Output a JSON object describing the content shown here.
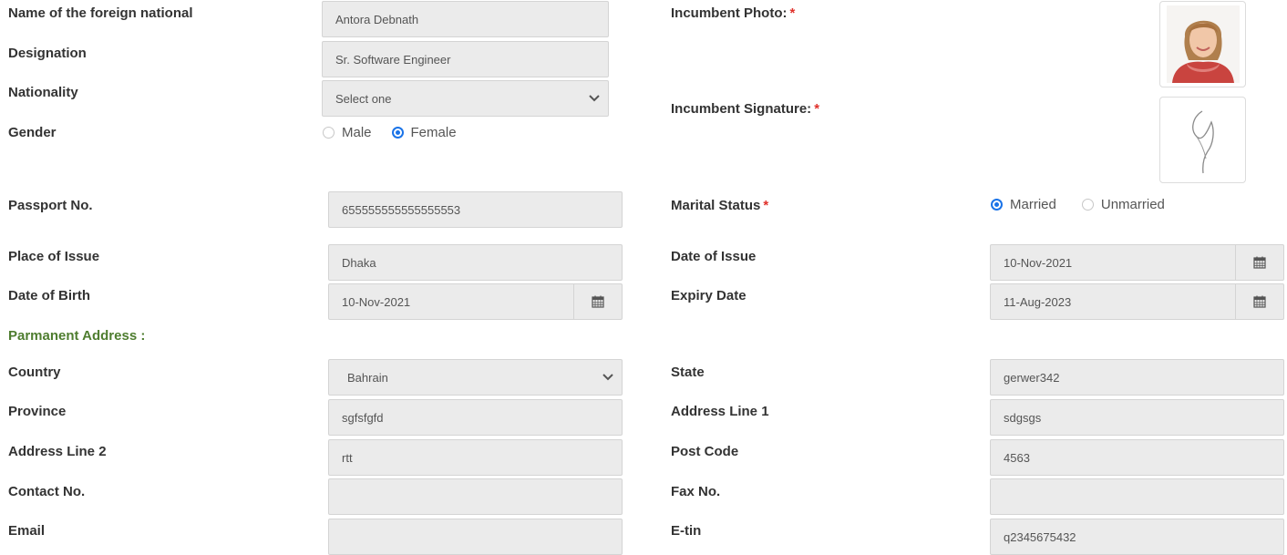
{
  "labels": {
    "name": "Name of the foreign national",
    "designation": "Designation",
    "nationality": "Nationality",
    "gender": "Gender",
    "passport": "Passport No.",
    "place_of_issue": "Place of Issue",
    "date_of_birth": "Date of Birth",
    "permanent_address": "Parmanent Address :",
    "country": "Country",
    "province": "Province",
    "address_line_2": "Address Line 2",
    "contact": "Contact No.",
    "email": "Email",
    "incumbent_photo": "Incumbent Photo:",
    "incumbent_signature": "Incumbent Signature:",
    "marital_status": "Marital Status",
    "date_of_issue": "Date of Issue",
    "expiry_date": "Expiry Date",
    "state": "State",
    "address_line_1": "Address Line 1",
    "post_code": "Post Code",
    "fax": "Fax No.",
    "etin": "E-tin",
    "required_mark": "*"
  },
  "values": {
    "name": "Antora Debnath",
    "designation": "Sr. Software Engineer",
    "nationality": "Select one",
    "passport": "655555555555555553",
    "place_of_issue": "Dhaka",
    "date_of_birth": "10-Nov-2021",
    "country": "Bahrain",
    "province": "sgfsfgfd",
    "address_line_2": "rtt",
    "contact": "",
    "email": "",
    "date_of_issue": "10-Nov-2021",
    "expiry_date": "11-Aug-2023",
    "state": "gerwer342",
    "address_line_1": "sdgsgs",
    "post_code": "4563",
    "fax": "",
    "etin": "q2345675432"
  },
  "gender": {
    "options": [
      "Male",
      "Female"
    ],
    "selected": "Female"
  },
  "marital": {
    "options": [
      "Married",
      "Unmarried"
    ],
    "selected": "Married"
  },
  "icons": {
    "select": "chevron-down-icon",
    "date": "calendar-icon"
  },
  "colors": {
    "radio_selected": "#1a73e8",
    "required": "#e0312b",
    "section": "#4e7d2f",
    "field_bg": "#ebebeb"
  }
}
